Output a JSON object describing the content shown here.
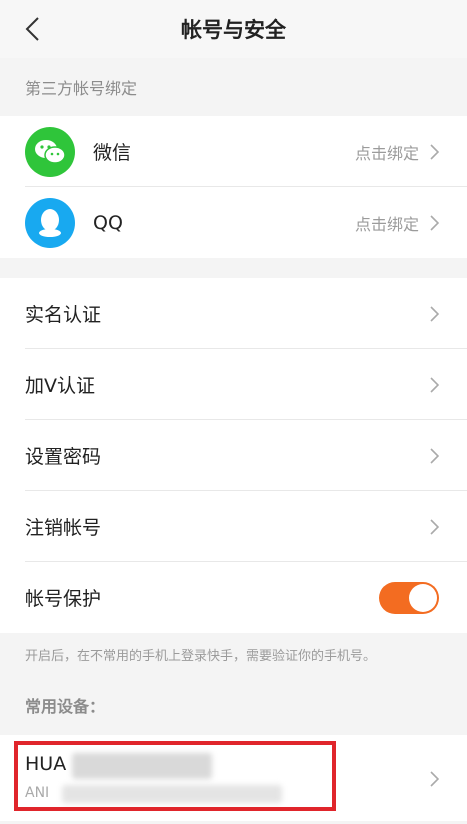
{
  "header": {
    "title": "帐号与安全",
    "back_icon": "chevron-left-icon"
  },
  "third_party": {
    "section_label": "第三方帐号绑定",
    "accounts": [
      {
        "name": "微信",
        "action": "点击绑定",
        "icon": "wechat-icon",
        "color": "#2fc53a"
      },
      {
        "name": "QQ",
        "action": "点击绑定",
        "icon": "qq-icon",
        "color": "#18a9f0"
      }
    ]
  },
  "settings": [
    {
      "label": "实名认证"
    },
    {
      "label": "加V认证"
    },
    {
      "label": "设置密码"
    },
    {
      "label": "注销帐号"
    }
  ],
  "protection": {
    "label": "帐号保护",
    "enabled": true,
    "toggle_color": "#f36c21"
  },
  "note": "开启后，在不常用的手机上登录快手，需要验证你的手机号。",
  "devices": {
    "section_label": "常用设备：",
    "items": [
      {
        "name_prefix": "HUA",
        "model_prefix": "ANI"
      }
    ],
    "highlight_color": "#e0252b"
  }
}
